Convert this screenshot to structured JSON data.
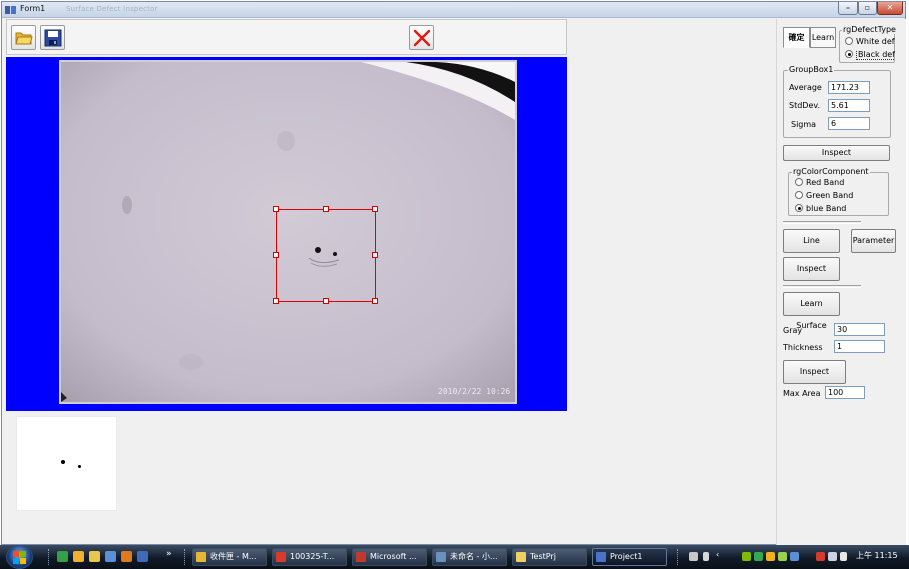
{
  "window": {
    "title": "Form1",
    "ghost_title": "Surface Defect Inspector"
  },
  "toolbar": {
    "open": "open",
    "save": "save",
    "delete": "delete"
  },
  "image": {
    "timestamp": "2010/2/22 10:26"
  },
  "panel": {
    "tabs": [
      "確定",
      "Learn"
    ],
    "defect_type": {
      "legend": "rgDefectType",
      "options": [
        "White defe",
        "Black defe"
      ],
      "selected": 1
    },
    "group1": {
      "legend": "GroupBox1",
      "average_label": "Average",
      "average_value": "171.23",
      "stddev_label": "StdDev.",
      "stddev_value": "5.61",
      "sigma_label": "Sigma",
      "sigma_value": "6"
    },
    "inspect1": "Inspect",
    "color_component": {
      "legend": "rgColorComponent",
      "options": [
        "Red Band",
        "Green Band",
        "blue Band"
      ],
      "selected": 2
    },
    "line_button": "Line",
    "parameter_button": "Parameter",
    "inspect2": "Inspect",
    "learn_surface": "Learn Surface",
    "gray_label": "Gray",
    "gray_value": "30",
    "thickness_label": "Thickness",
    "thickness_value": "1",
    "inspect3": "Inspect",
    "max_area_label": "Max Area",
    "max_area_value": "100"
  },
  "taskbar": {
    "items": [
      "收件匣 - M...",
      "100325-T...",
      "Microsoft ...",
      "未命名 - 小...",
      "TestPrj",
      "Project1"
    ],
    "clock": "上午 11:15"
  }
}
